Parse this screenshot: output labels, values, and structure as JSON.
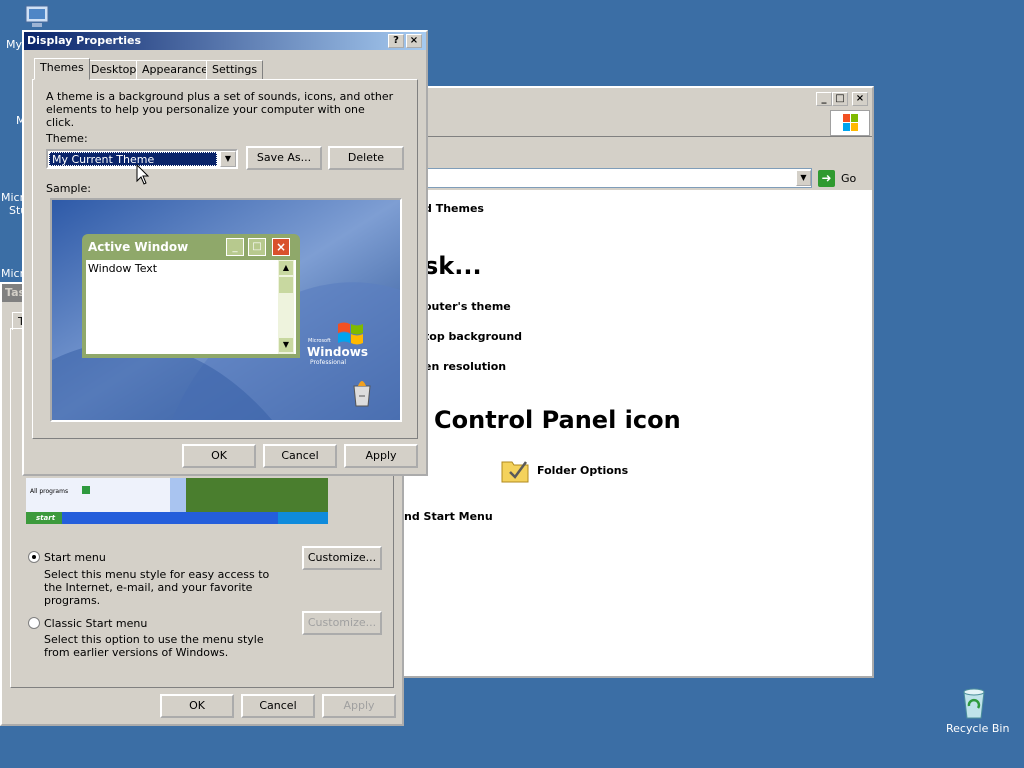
{
  "desktop": {
    "my_computer_label": "My",
    "left_clip_labels": [
      "M",
      "Micro",
      "Stu",
      "Micro"
    ],
    "recycle_bin_label": "Recycle Bin"
  },
  "explorer": {
    "go_label": "Go",
    "heading_themes": "d Themes",
    "heading_task": "sk...",
    "links": [
      "outer's theme",
      "top background",
      "en resolution"
    ],
    "heading_cp_icon": "Control Panel icon",
    "folder_options": "Folder Options",
    "start_menu_link": "nd Start Menu"
  },
  "taskbar_props": {
    "title_clip": "Tas",
    "tab_clip": "T",
    "start_menu_label": "Start menu",
    "start_menu_desc": "Select this menu style for easy access to the Internet, e-mail, and your favorite programs.",
    "classic_label": "Classic Start menu",
    "classic_desc": "Select this option to use the menu style from earlier versions of Windows.",
    "customize_label": "Customize...",
    "customize_disabled_label": "Customize...",
    "ok_label": "OK",
    "cancel_label": "Cancel",
    "apply_label": "Apply",
    "preview_all_programs": "All programs",
    "preview_start": "start"
  },
  "display_props": {
    "title": "Display Properties",
    "help_btn": "?",
    "close_btn": "×",
    "tabs": [
      "Themes",
      "Desktop",
      "Appearance",
      "Settings"
    ],
    "description": "A theme is a background plus a set of sounds, icons, and other elements to help you personalize your computer with one click.",
    "theme_label": "Theme:",
    "theme_value": "My Current Theme",
    "save_as_label": "Save As...",
    "delete_label": "Delete",
    "sample_label": "Sample:",
    "sample_window_title": "Active Window",
    "sample_window_text": "Window Text",
    "windows_brand_small": "Microsoft",
    "windows_brand": "Windows",
    "windows_edition": "Professional",
    "ok_label": "OK",
    "cancel_label": "Cancel",
    "apply_label": "Apply"
  },
  "colors": {
    "desktop": "#3b6ea5",
    "title_active": "#0a246a",
    "face": "#d4d0c8",
    "selection": "#0a246a"
  }
}
